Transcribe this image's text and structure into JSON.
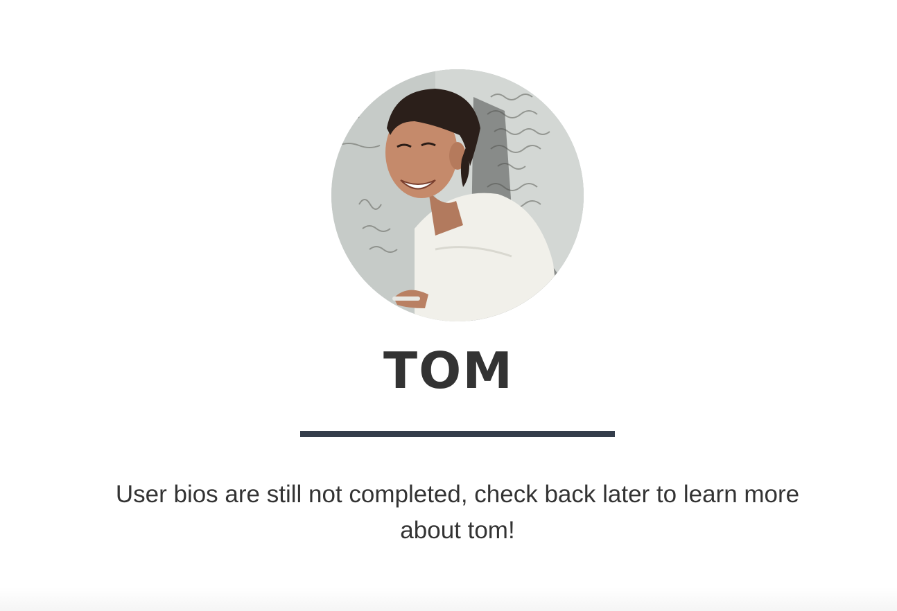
{
  "profile": {
    "avatar_alt": "Profile photo of Tom",
    "name": "TOM",
    "bio": "User bios are still not completed, check back later to learn more about tom!"
  },
  "colors": {
    "text": "#333333",
    "divider": "#343d4b",
    "background": "#ffffff"
  }
}
